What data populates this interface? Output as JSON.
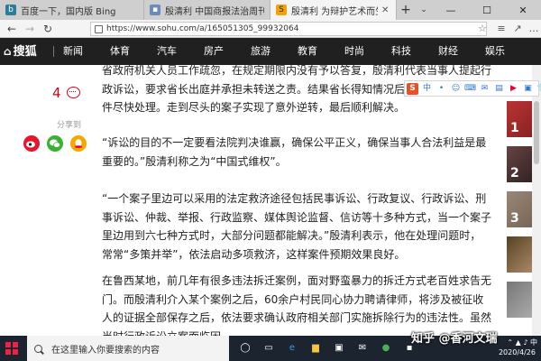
{
  "browser": {
    "tabs": [
      {
        "label": "百度一下，国内版 Bing",
        "active": false,
        "icon": "bing-icon"
      },
      {
        "label": "殷清利 中国商报法治周刊 &",
        "active": false,
        "icon": "page-icon"
      },
      {
        "label": "殷清利 为辩护艺术而生",
        "active": true,
        "icon": "sohu-icon"
      }
    ],
    "new_tab": "+",
    "tab_menu": "⌄",
    "window_controls": {
      "minimize": "—",
      "maximize": "☐",
      "close": "✕"
    },
    "url": "https://www.sohu.com/a/165051305_99932064",
    "nav": {
      "back": "←",
      "forward": "→",
      "refresh": "↻"
    }
  },
  "sohu_nav": {
    "logo": "搜狐",
    "items": [
      "新闻",
      "体育",
      "汽车",
      "房产",
      "旅游",
      "教育",
      "时尚",
      "科技",
      "财经",
      "娱乐"
    ]
  },
  "sidebar": {
    "comment_count": "4",
    "share_label": "分享到",
    "share_targets": [
      "weibo-icon",
      "wechat-icon",
      "qq-icon"
    ]
  },
  "article": {
    "paragraphs": [
      "省政府机关人员工作疏忽，在规定期限内没有予以答复，殷清利代表当事人提起行政诉讼，要求省长出庭并承担未转送之责。结果省长得知情况后非常重视，批示案件尽快处理。走到尽头的案子实现了意外逆转，最后顺利解决。",
      "“诉讼的目的不一定要看法院判决谁赢，确保公平正义，确保当事人合法利益是最重要的。”殷清利称之为“中国式维权”。",
      "“一个案子里边可以采用的法定救济途径包括民事诉讼、行政复议、行政诉讼、刑事诉讼、仲裁、举报、行政监察、媒体舆论监督、信访等十多种方式，当一个案子里边用到六七种方式时，大部分问题都能解决。”殷清利表示，他在处理问题时，常常“多策并举”，依法启动多项救济，这样案件预期效果良好。",
      "在鲁西某地，前几年有很多违法拆迁案例，面对野蛮暴力的拆迁方式老百姓求告无门。而殷清利介入某个案例之后，60余户村民同心协力聘请律师，将涉及被征收人的证据全部保存之后，依法要求确认政府相关部门实施拆除行为的违法性。虽然当时行政诉讼立案面临困"
    ]
  },
  "ime_bar": [
    "S",
    "中",
    "•",
    "☺",
    "⌨",
    "✉",
    "▤",
    "▶",
    "▣",
    "👕",
    "▦"
  ],
  "right_ads": [
    "1",
    "2",
    "3",
    "",
    ""
  ],
  "taskbar": {
    "search_placeholder": "在这里输入你要搜索的内容",
    "watermark": "知乎 @香河文瑞",
    "date": "2020/4/26",
    "icons": [
      "cortana-icon",
      "task-view-icon",
      "edge-icon",
      "explorer-icon",
      "store-icon",
      "mail-icon",
      "chrome-icon",
      "app-icon"
    ]
  },
  "colors": {
    "sohu_nav_bg": "#202020",
    "accent_red": "#d0021b",
    "taskbar_bg": "#1c2430"
  }
}
